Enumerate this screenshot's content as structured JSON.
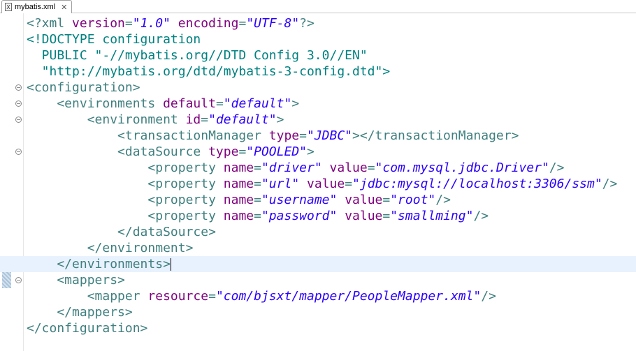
{
  "tab": {
    "icon": "xml-file-icon",
    "title": "mybatis.xml",
    "close": "✕"
  },
  "lines": [
    {
      "parts": [
        [
          "t",
          "<?xml "
        ],
        [
          "a",
          "version"
        ],
        [
          "t",
          "="
        ],
        [
          "v",
          "\"1.0\""
        ],
        [
          "t",
          " "
        ],
        [
          "a",
          "encoding"
        ],
        [
          "t",
          "="
        ],
        [
          "v",
          "\"UTF-8\""
        ],
        [
          "t",
          "?>"
        ]
      ],
      "fold": false,
      "current": false
    },
    {
      "parts": [
        [
          "dt",
          "<!DOCTYPE configuration"
        ]
      ],
      "fold": false,
      "current": false
    },
    {
      "parts": [
        [
          "dt",
          "  PUBLIC \"-//mybatis.org//DTD Config 3.0//EN\""
        ]
      ],
      "fold": false,
      "current": false
    },
    {
      "parts": [
        [
          "dt",
          "  \"http://mybatis.org/dtd/mybatis-3-config.dtd\">"
        ]
      ],
      "fold": false,
      "current": false
    },
    {
      "parts": [
        [
          "t",
          "<configuration>"
        ]
      ],
      "fold": true,
      "current": false
    },
    {
      "parts": [
        [
          "t",
          "    <environments "
        ],
        [
          "a",
          "default"
        ],
        [
          "t",
          "="
        ],
        [
          "v",
          "\"default\""
        ],
        [
          "t",
          ">"
        ]
      ],
      "fold": true,
      "current": false
    },
    {
      "parts": [
        [
          "t",
          "        <environment "
        ],
        [
          "a",
          "id"
        ],
        [
          "t",
          "="
        ],
        [
          "v",
          "\"default\""
        ],
        [
          "t",
          ">"
        ]
      ],
      "fold": true,
      "current": false
    },
    {
      "parts": [
        [
          "t",
          "            <transactionManager "
        ],
        [
          "a",
          "type"
        ],
        [
          "t",
          "="
        ],
        [
          "v",
          "\"JDBC\""
        ],
        [
          "t",
          "></transactionManager>"
        ]
      ],
      "fold": false,
      "current": false
    },
    {
      "parts": [
        [
          "t",
          "            <dataSource "
        ],
        [
          "a",
          "type"
        ],
        [
          "t",
          "="
        ],
        [
          "v",
          "\"POOLED\""
        ],
        [
          "t",
          ">"
        ]
      ],
      "fold": true,
      "current": false
    },
    {
      "parts": [
        [
          "t",
          "                <property "
        ],
        [
          "a",
          "name"
        ],
        [
          "t",
          "="
        ],
        [
          "v",
          "\"driver\""
        ],
        [
          "t",
          " "
        ],
        [
          "a",
          "value"
        ],
        [
          "t",
          "="
        ],
        [
          "v",
          "\"com.mysql.jdbc.Driver\""
        ],
        [
          "t",
          "/>"
        ]
      ],
      "fold": false,
      "current": false
    },
    {
      "parts": [
        [
          "t",
          "                <property "
        ],
        [
          "a",
          "name"
        ],
        [
          "t",
          "="
        ],
        [
          "v",
          "\"url\""
        ],
        [
          "t",
          " "
        ],
        [
          "a",
          "value"
        ],
        [
          "t",
          "="
        ],
        [
          "v",
          "\"jdbc:mysql://localhost:3306/ssm\""
        ],
        [
          "t",
          "/>"
        ]
      ],
      "fold": false,
      "current": false
    },
    {
      "parts": [
        [
          "t",
          "                <property "
        ],
        [
          "a",
          "name"
        ],
        [
          "t",
          "="
        ],
        [
          "v",
          "\"username\""
        ],
        [
          "t",
          " "
        ],
        [
          "a",
          "value"
        ],
        [
          "t",
          "="
        ],
        [
          "v",
          "\"root\""
        ],
        [
          "t",
          "/>"
        ]
      ],
      "fold": false,
      "current": false
    },
    {
      "parts": [
        [
          "t",
          "                <property "
        ],
        [
          "a",
          "name"
        ],
        [
          "t",
          "="
        ],
        [
          "v",
          "\"password\""
        ],
        [
          "t",
          " "
        ],
        [
          "a",
          "value"
        ],
        [
          "t",
          "="
        ],
        [
          "v",
          "\"smallming\""
        ],
        [
          "t",
          "/>"
        ]
      ],
      "fold": false,
      "current": false
    },
    {
      "parts": [
        [
          "t",
          "            </dataSource>"
        ]
      ],
      "fold": false,
      "current": false
    },
    {
      "parts": [
        [
          "t",
          "        </environment>"
        ]
      ],
      "fold": false,
      "current": false
    },
    {
      "parts": [
        [
          "t",
          "    </environments>"
        ]
      ],
      "fold": false,
      "current": true
    },
    {
      "parts": [
        [
          "t",
          "    <mappers>"
        ]
      ],
      "fold": true,
      "current": false
    },
    {
      "parts": [
        [
          "t",
          "        <mapper "
        ],
        [
          "a",
          "resource"
        ],
        [
          "t",
          "="
        ],
        [
          "v",
          "\"com/bjsxt/mapper/PeopleMapper.xml\""
        ],
        [
          "t",
          "/>"
        ]
      ],
      "fold": false,
      "current": false
    },
    {
      "parts": [
        [
          "t",
          "    </mappers>"
        ]
      ],
      "fold": false,
      "current": false
    },
    {
      "parts": [
        [
          "t",
          "</configuration>"
        ]
      ],
      "fold": false,
      "current": false
    }
  ],
  "colors": {
    "tag": "#3f7f7f",
    "attribute": "#7f007f",
    "value": "#2a00ff",
    "current_line": "#e8f2fe"
  }
}
